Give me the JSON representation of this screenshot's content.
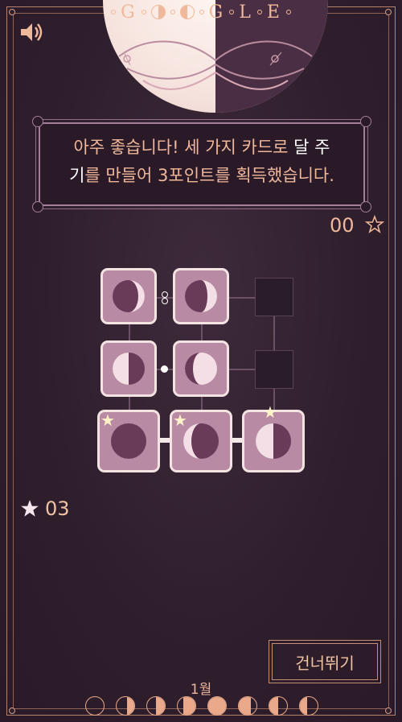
{
  "header": {
    "logo_letters": [
      "G",
      "G",
      "L",
      "E"
    ]
  },
  "message": {
    "line1_before": "아주 좋습니다! 세 가지 카드로 ",
    "line1_highlight": "달 주",
    "line2_highlight": "기",
    "line2_after": "를 만들어 3포인트를 획득했습니다."
  },
  "score": {
    "top_value": "00",
    "bottom_value": "03"
  },
  "buttons": {
    "skip_label": "건너뛰기"
  },
  "month": {
    "label": "1월"
  },
  "colors": {
    "accent": "#f0b89a",
    "card": "#b98aa3",
    "background": "#2f1f2d"
  },
  "icons": {
    "sound": "speaker-icon",
    "star": "star-icon"
  }
}
